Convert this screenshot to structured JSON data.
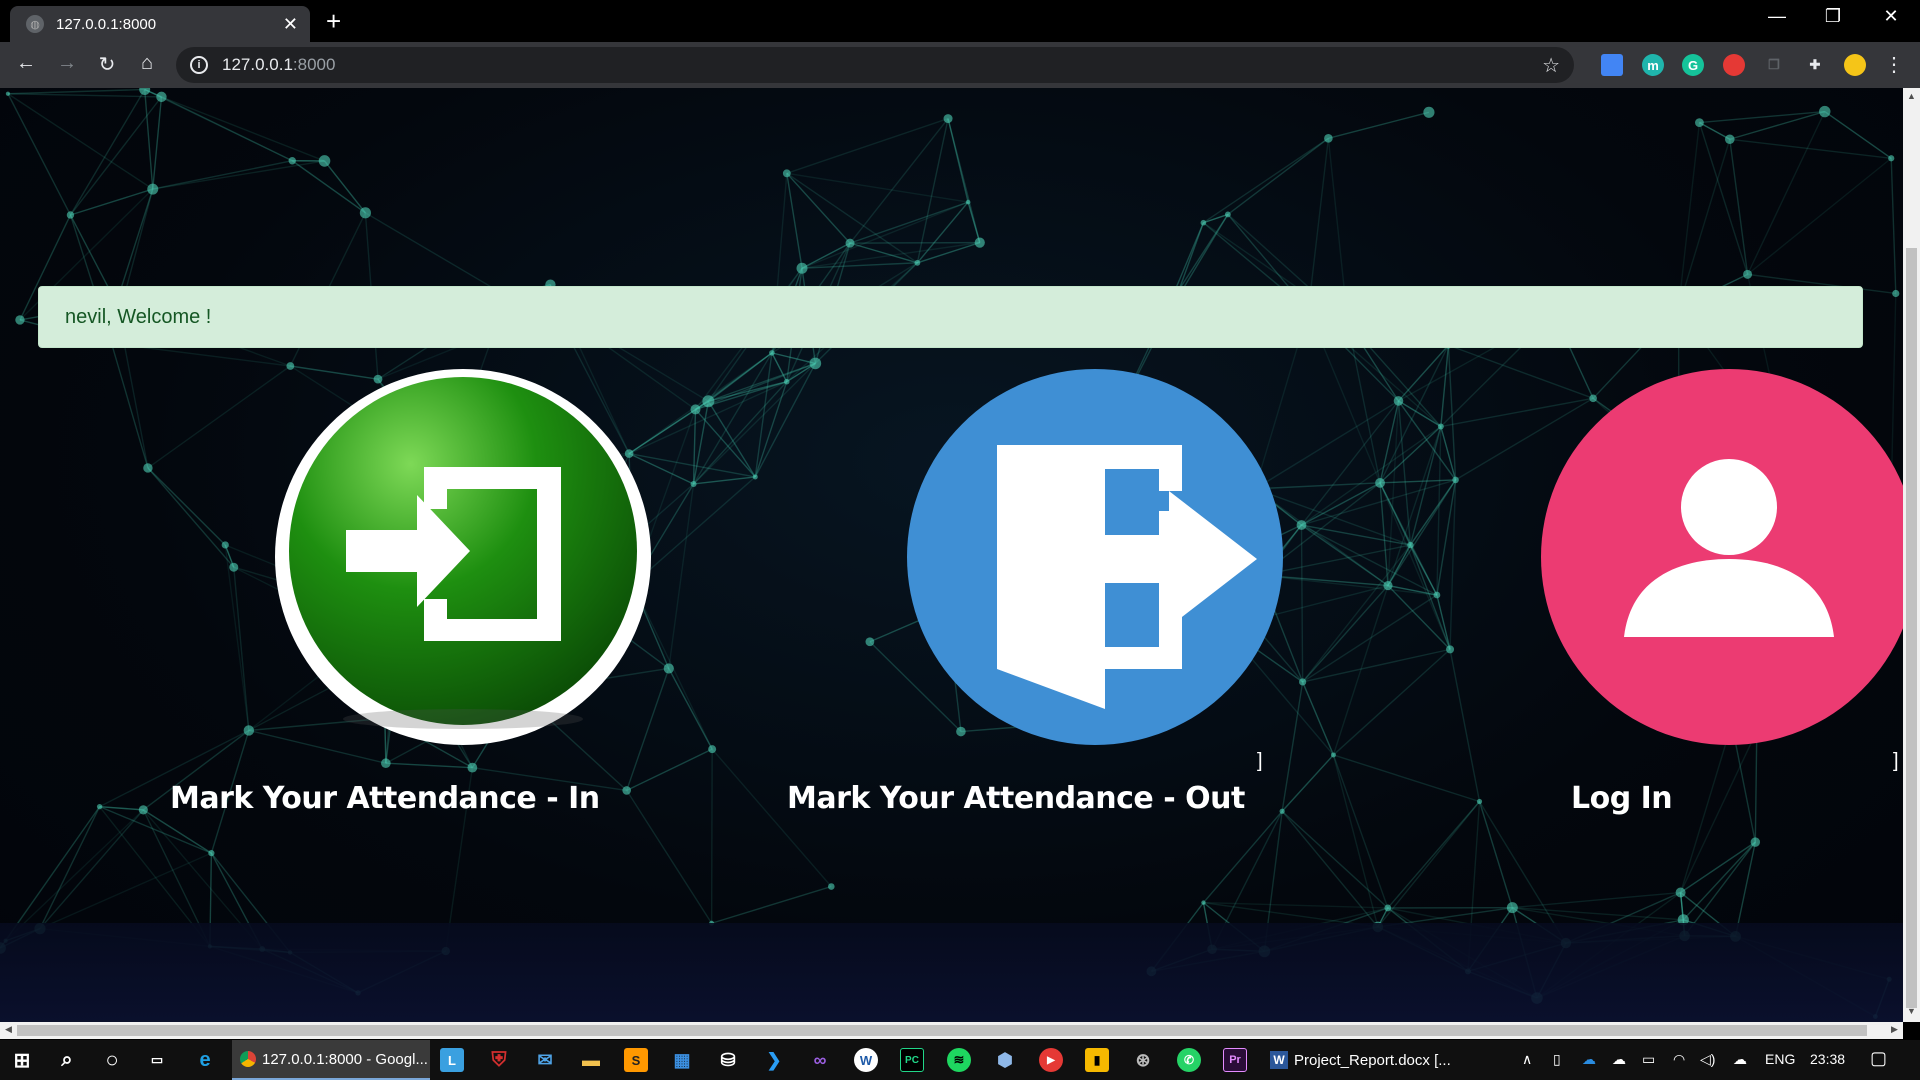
{
  "browser": {
    "tab_title": "127.0.0.1:8000",
    "url_host": "127.0.0.1",
    "url_port": ":8000",
    "window_controls": [
      "minimize",
      "restore",
      "close"
    ],
    "extensions": [
      {
        "name": "sheets-extension-icon",
        "color": "#4285f4",
        "glyph": ""
      },
      {
        "name": "m-extension-icon",
        "color": "#1fb5ac",
        "glyph": "m"
      },
      {
        "name": "grammarly-icon",
        "color": "#15c39a",
        "glyph": "G"
      },
      {
        "name": "hand-extension-icon",
        "color": "#e53935",
        "glyph": ""
      },
      {
        "name": "copy-extension-icon",
        "color": "#5f6368",
        "glyph": ""
      },
      {
        "name": "extensions-puzzle-icon",
        "color": "#e8eaed",
        "glyph": ""
      },
      {
        "name": "profile-avatar",
        "color": "#f5c518",
        "glyph": ""
      }
    ]
  },
  "page": {
    "alert_message": "nevil, Welcome !",
    "cards": [
      {
        "label": "Mark Your Attendance - In",
        "color": "#1a8a1a",
        "icon": "sign-in-icon"
      },
      {
        "label": "Mark Your Attendance - Out",
        "color": "#3f8fd4",
        "icon": "exit-door-icon"
      },
      {
        "label": "Log In",
        "color": "#ec3b72",
        "icon": "user-icon"
      }
    ],
    "stray_brackets": [
      "]",
      "]"
    ]
  },
  "taskbar": {
    "chrome_app_label": "127.0.0.1:8000 - Googl...",
    "word_app_label": "Project_Report.docx [...",
    "language": "ENG",
    "time": "23:38"
  }
}
